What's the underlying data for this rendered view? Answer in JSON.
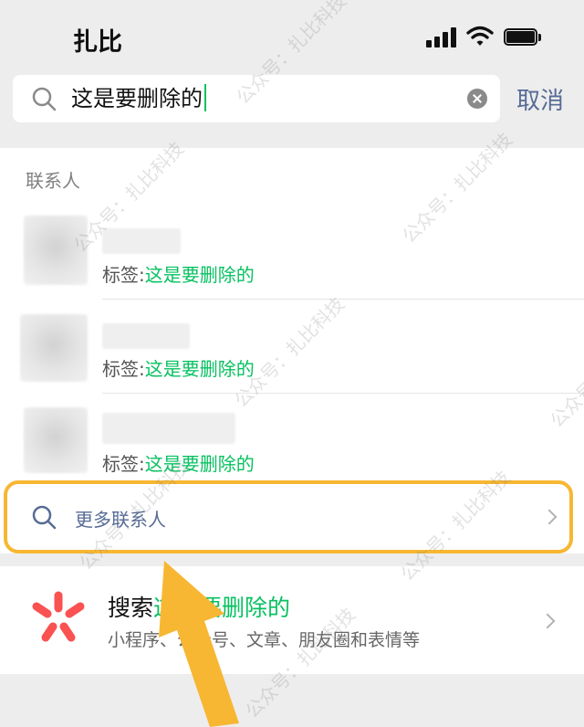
{
  "status_bar": {
    "carrier": "扎比"
  },
  "search": {
    "query": "这是要删除的",
    "cancel_label": "取消"
  },
  "contacts": {
    "section_title": "联系人",
    "items": [
      {
        "tag_label": "标签:",
        "tag_value": "这是要删除的"
      },
      {
        "tag_label": "标签:",
        "tag_value": "这是要删除的"
      },
      {
        "tag_label": "标签:",
        "tag_value": "这是要删除的"
      }
    ],
    "more_label": "更多联系人"
  },
  "search_all": {
    "title_prefix": "搜索",
    "title_query": "这是要删除的",
    "subtitle": "小程序、公众号、文章、朋友圈和表情等"
  },
  "watermark": {
    "text": "公众号：扎比科技"
  },
  "colors": {
    "accent_green": "#07c160",
    "link_blue": "#576b95",
    "highlight_orange": "#f7b733"
  }
}
